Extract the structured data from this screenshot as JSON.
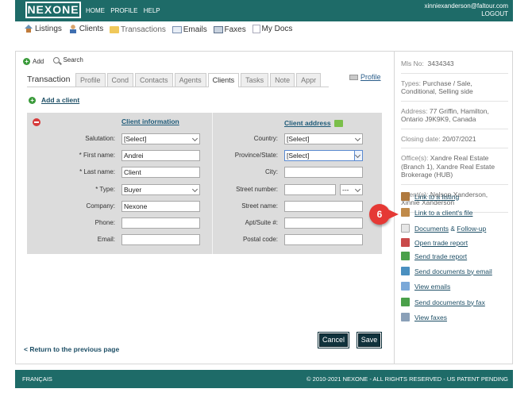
{
  "header": {
    "logo": "NEXONE",
    "nav": [
      "HOME",
      "PROFILE",
      "HELP"
    ],
    "user_email": "xinniexanderson@faltour.com",
    "logout": "LOGOUT"
  },
  "main_nav": [
    {
      "label": "Listings",
      "icon": "house-icon"
    },
    {
      "label": "Clients",
      "icon": "person-icon"
    },
    {
      "label": "Transactions",
      "icon": "folder-icon"
    },
    {
      "label": "Emails",
      "icon": "mail-icon"
    },
    {
      "label": "Faxes",
      "icon": "fax-icon"
    },
    {
      "label": "My Docs",
      "icon": "docs-icon"
    }
  ],
  "toolbar": {
    "add": "Add",
    "search": "Search"
  },
  "tabs": {
    "title": "Transaction",
    "items": [
      "Profile",
      "Cond",
      "Contacts",
      "Agents",
      "Clients",
      "Tasks",
      "Note",
      "Appr"
    ],
    "active": "Clients",
    "profile_link": "Profile"
  },
  "add_client": "Add a client",
  "client_info": {
    "title": "Client information",
    "fields": [
      {
        "label": "Salutation:",
        "value": "[Select]",
        "type": "select"
      },
      {
        "label": "* First name:",
        "value": "Andrei",
        "type": "text"
      },
      {
        "label": "* Last name:",
        "value": "Client",
        "type": "text"
      },
      {
        "label": "* Type:",
        "value": "Buyer",
        "type": "select"
      },
      {
        "label": "Company:",
        "value": "Nexone",
        "type": "text"
      },
      {
        "label": "Phone:",
        "value": "",
        "type": "text"
      },
      {
        "label": "Email:",
        "value": "",
        "type": "text"
      }
    ]
  },
  "client_address": {
    "title": "Client address",
    "fields": [
      {
        "label": "Country:",
        "value": "[Select]",
        "type": "select"
      },
      {
        "label": "Province/State:",
        "value": "[Select]",
        "type": "select"
      },
      {
        "label": "City:",
        "value": "",
        "type": "text"
      },
      {
        "label": "Street number:",
        "value": "",
        "type": "text",
        "extra": "---"
      },
      {
        "label": "Street name:",
        "value": "",
        "type": "text"
      },
      {
        "label": "Apt/Suite #:",
        "value": "",
        "type": "text"
      },
      {
        "label": "Postal code:",
        "value": "",
        "type": "text"
      }
    ]
  },
  "buttons": {
    "cancel": "Cancel",
    "save": "Save"
  },
  "back_link": "< Return to the previous page",
  "sidebar": {
    "mls": {
      "label": "Mls No:",
      "value": "3434343"
    },
    "types": {
      "label": "Types:",
      "value": "Purchase / Sale, Conditional, Selling side"
    },
    "address": {
      "label": "Address:",
      "value": "77 Griffin, Hamilton, Ontario J9K9K9, Canada"
    },
    "closing": {
      "label": "Closing date:",
      "value": "20/07/2021"
    },
    "offices": {
      "label": "Office(s):",
      "value": "Xandre Real Estate (Branch 1), Xandre Real Estate Brokerage (HUB)"
    },
    "agents": {
      "label": "Agent(s):",
      "value": "Nelson Xanderson, Xinnie Xanderson"
    },
    "links": [
      {
        "label": "Link to a listing",
        "icon": "house-icon",
        "color": "#b07a3f"
      },
      {
        "label": "Link to a client's file",
        "icon": "person-icon",
        "color": "#c08a4a"
      },
      {
        "label": "Documents",
        "label2": "Follow-up",
        "joiner": "&",
        "icon": "document-icon",
        "color": "#e6e6e6"
      },
      {
        "label": "Open trade report",
        "icon": "report-icon",
        "color": "#c94a4a"
      },
      {
        "label": "Send trade report",
        "icon": "send-report-icon",
        "color": "#4aa04a"
      },
      {
        "label": "Send documents by email",
        "icon": "email-icon",
        "color": "#4a90c0"
      },
      {
        "label": "View emails",
        "icon": "mail-icon",
        "color": "#7aa8d8"
      },
      {
        "label": "Send documents by fax",
        "icon": "fax-icon",
        "color": "#4aa04a"
      },
      {
        "label": "View faxes",
        "icon": "fax-view-icon",
        "color": "#8aa0b8"
      }
    ]
  },
  "callout_number": "6",
  "footer": {
    "language": "FRANÇAIS",
    "copyright": "© 2010-2021 NEXONE - ALL RIGHTS RESERVED - US PATENT PENDING"
  },
  "colors": {
    "brand": "#1e6b68",
    "button": "#10323c",
    "callout": "#e53935",
    "form_bg": "#dcdcdc"
  }
}
